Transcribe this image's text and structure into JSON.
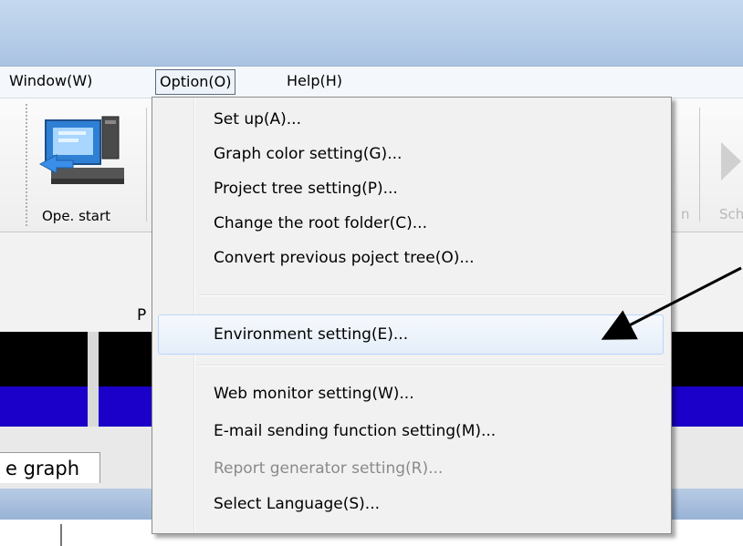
{
  "menubar": {
    "items": [
      {
        "label": "Window(W)"
      },
      {
        "label": "Option(O)"
      },
      {
        "label": "Help(H)"
      }
    ]
  },
  "toolbar": {
    "ope_start_label": "Ope. start",
    "partial_label_1": "n",
    "partial_label_2": "Sch"
  },
  "main": {
    "partial_label": "P",
    "tab_label": "e graph"
  },
  "dropdown": {
    "items": [
      {
        "label": "Set up(A)...",
        "enabled": true
      },
      {
        "label": "Graph color setting(G)...",
        "enabled": true
      },
      {
        "label": "Project tree setting(P)...",
        "enabled": true
      },
      {
        "label": "Change the root folder(C)...",
        "enabled": true
      },
      {
        "label": "Convert previous poject tree(O)...",
        "enabled": true
      },
      {
        "label": "Environment setting(E)...",
        "enabled": true,
        "highlighted": true
      },
      {
        "label": "Web monitor setting(W)...",
        "enabled": true
      },
      {
        "label": "E-mail sending function setting(M)...",
        "enabled": true
      },
      {
        "label": "Report generator setting(R)...",
        "enabled": false
      },
      {
        "label": "Select Language(S)...",
        "enabled": true
      }
    ]
  },
  "colors": {
    "accent_blue": "#1a00c8",
    "highlight_border": "#b8d6fb",
    "annotation_arrow": "#000000"
  }
}
